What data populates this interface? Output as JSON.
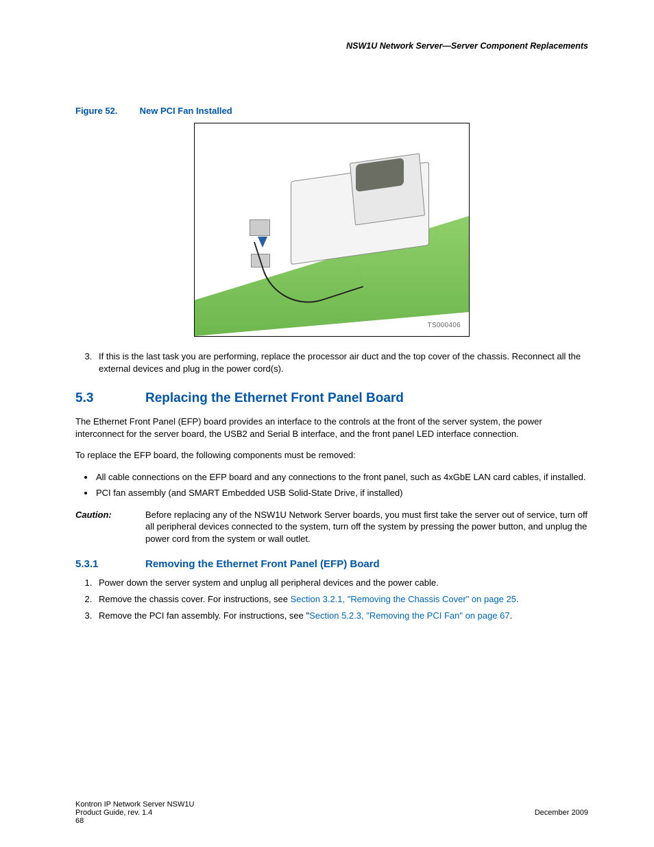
{
  "header": {
    "running": "NSW1U Network Server—Server Component Replacements"
  },
  "figure": {
    "label": "Figure 52.",
    "title": "New PCI Fan Installed",
    "id": "TS000406"
  },
  "step3": {
    "num": "3.",
    "text": "If this is the last task you are performing, replace the processor air duct and the top cover of the chassis. Reconnect all the external devices and plug in the power cord(s)."
  },
  "sec53": {
    "num": "5.3",
    "title": "Replacing the Ethernet Front Panel Board",
    "p1": "The Ethernet Front Panel (EFP) board provides an interface to the controls at the front of the server system, the power interconnect for the server board, the USB2 and Serial B interface, and the front panel LED interface connection.",
    "p2": "To replace the EFP board, the following components must be removed:",
    "bullets": [
      "All cable connections on the EFP board and any connections to the front panel, such as 4xGbE LAN card cables, if installed.",
      "PCI fan assembly (and SMART Embedded USB Solid-State Drive, if installed)"
    ],
    "caution_label": "Caution:",
    "caution_text": "Before replacing any of the NSW1U Network Server boards, you must first take the server out of service, turn off all peripheral devices connected to the system, turn off the system by pressing the power button, and unplug the power cord from the system or wall outlet."
  },
  "sec531": {
    "num": "5.3.1",
    "title": "Removing the Ethernet Front Panel (EFP) Board",
    "steps": {
      "s1": "Power down the server system and unplug all peripheral devices and the power cable.",
      "s2_a": "Remove the chassis cover. For instructions, see ",
      "s2_link": "Section 3.2.1, \"Removing the Chassis Cover\" on page 25",
      "s2_b": ".",
      "s3_a": "Remove the PCI fan assembly. For instructions, see \"",
      "s3_link": "Section 5.2.3, \"Removing the PCI Fan\" on page 67",
      "s3_b": "."
    }
  },
  "footer": {
    "l1_left": "Kontron IP Network Server NSW1U",
    "l2_left": "Product Guide, rev. 1.4",
    "l2_right": "December 2009",
    "l3_left": "68"
  }
}
